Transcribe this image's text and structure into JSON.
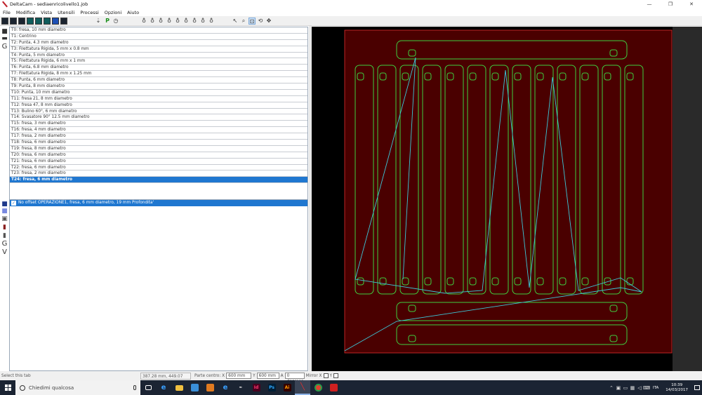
{
  "window": {
    "title": "DeltaCam - sediaenricolivello1.job",
    "minimize": "—",
    "maximize": "❐",
    "close": "✕"
  },
  "menu": [
    "File",
    "Modifica",
    "Vista",
    "Utensili",
    "Processi",
    "Opzioni",
    "Aiuto"
  ],
  "toolbar": {
    "p_label": "P"
  },
  "tools": [
    "T0: fresa, 10 mm diametro",
    "T1: Centrino",
    "T2: Punta, 4.3 mm diametro",
    "T3: Filettatura Rigida, 5 mm x 0.8 mm",
    "T4: Punta, 5 mm diametro",
    "T5: Filettatura Rigida, 6 mm x 1 mm",
    "T6: Punta, 6.8 mm diametro",
    "T7: Filettatura Rigida, 8 mm x 1.25 mm",
    "T8: Punta, 6 mm diametro",
    "T9: Punta, 8 mm diametro",
    "T10: Punta, 10 mm diametro",
    "T11: fresa 21, 8 mm diametro",
    "T12: fresa 47, 8 mm diametro",
    "T13: Bulino 60°, 6 mm diametro",
    "T14: Svasatore 90° 12.5 mm diametro",
    "T15: fresa, 3 mm diametro",
    "T16: fresa, 4 mm diametro",
    "T17: fresa, 2 mm diametro",
    "T18: fresa, 6 mm diametro",
    "T19: fresa, 8 mm diametro",
    "T20: fresa, 6 mm diametro",
    "T21: fresa, 6 mm diametro",
    "T22: fresa, 6 mm diametro",
    "T23: fresa, 2 mm diametro",
    "T24: fresa, 6 mm diametro"
  ],
  "selected_tool_index": 24,
  "operation": {
    "check": "✓",
    "label": "No offset OPERAZIONE1, fresa, 6 mm diametro, 19 mm Profondita'"
  },
  "left_strip": {
    "g_label": "G",
    "g2_label": "G",
    "v_label": "V"
  },
  "status": {
    "hint": "Select this tab",
    "coords": "387.28 mm, 449.07 mm",
    "parte_centro_label": "Parte centro: X",
    "x_value": "600 mm",
    "y_label": "Y",
    "y_value": "600 mm",
    "a_label": "A",
    "a_value": "0 degrees",
    "mirror_label": "Mirror X",
    "mirror_y_label": "Y"
  },
  "taskbar": {
    "search_placeholder": "Chiedimi qualcosa",
    "lang": "ITA",
    "time": "10:39",
    "date": "14/03/2017"
  },
  "colors": {
    "canvas_bg": "#000000",
    "sheet": "#4a0000",
    "sheet_border": "#e03030",
    "part_outline": "#3fcf3f",
    "toolpath": "#3cc8d8",
    "selection": "#1f77d0"
  }
}
